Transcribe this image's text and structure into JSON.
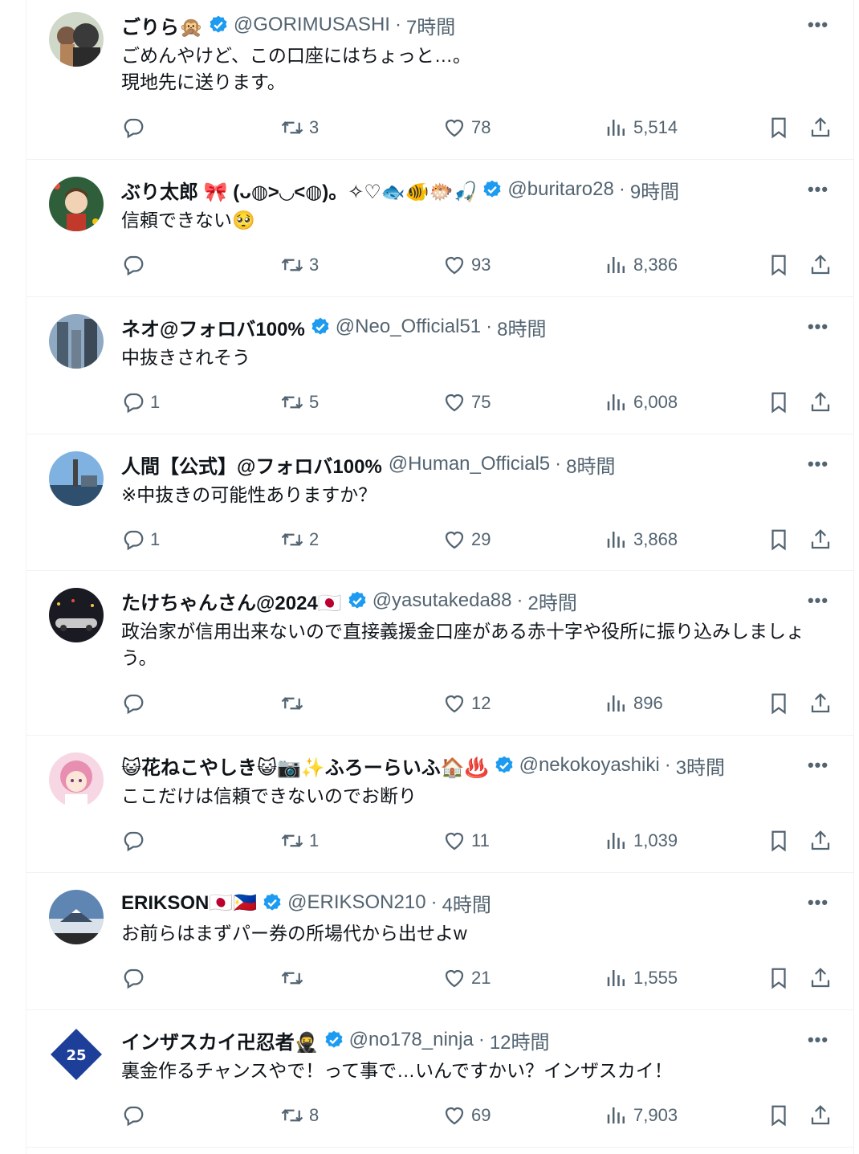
{
  "tweets": [
    {
      "name": "ごりら🙊",
      "verified": true,
      "handle": "@GORIMUSASHI",
      "time": "7時間",
      "text": "ごめんやけど、この口座にはちょっと…。\n現地先に送ります。",
      "replies": "",
      "retweets": "3",
      "likes": "78",
      "views": "5,514",
      "avatar_colors": [
        "#cfd8c9",
        "#3a3a3a"
      ]
    },
    {
      "name": "ぶり太郎 🎀 (ᴗ◍>◡<◍)。✧♡🐟🐠🐡🎣",
      "verified": true,
      "handle": "@buritaro28",
      "time": "9時間",
      "text": "信頼できない🥺",
      "replies": "",
      "retweets": "3",
      "likes": "93",
      "views": "8,386",
      "avatar_colors": [
        "#2e5f3a",
        "#c0392b"
      ]
    },
    {
      "name": "ネオ@フォロバ100%",
      "verified": true,
      "handle": "@Neo_Official51",
      "time": "8時間",
      "text": "中抜きされそう",
      "replies": "1",
      "retweets": "5",
      "likes": "75",
      "views": "6,008",
      "avatar_colors": [
        "#8fa9c2",
        "#4b5e70"
      ]
    },
    {
      "name": "人間【公式】@フォロバ100%",
      "verified": false,
      "handle": "@Human_Official5",
      "time": "8時間",
      "text": "※中抜きの可能性ありますか？",
      "replies": "1",
      "retweets": "2",
      "likes": "29",
      "views": "3,868",
      "avatar_colors": [
        "#7fb2e0",
        "#2f4f6f"
      ]
    },
    {
      "name": "たけちゃんさん@2024🇯🇵",
      "verified": true,
      "handle": "@yasutakeda88",
      "time": "2時間",
      "text": "政治家が信用出来ないので直接義援金口座がある赤十字や役所に振り込みしましょう。",
      "replies": "",
      "retweets": "",
      "likes": "12",
      "views": "896",
      "avatar_colors": [
        "#1a1a22",
        "#c8c8c8"
      ]
    },
    {
      "name": "😺花ねこやしき😺📷✨ふろーらいふ🏠♨️",
      "verified": true,
      "handle": "@nekokoyashiki",
      "time": "3時間",
      "text": "ここだけは信頼できないのでお断り",
      "replies": "",
      "retweets": "1",
      "likes": "11",
      "views": "1,039",
      "avatar_colors": [
        "#f7d7e3",
        "#e88fb1"
      ]
    },
    {
      "name": "ERIKSON🇯🇵🇵🇭",
      "verified": true,
      "handle": "@ERIKSON210",
      "time": "4時間",
      "text": "お前らはまずパー券の所場代から出せよw",
      "replies": "",
      "retweets": "",
      "likes": "21",
      "views": "1,555",
      "avatar_colors": [
        "#5f86b3",
        "#d9e2ea"
      ]
    },
    {
      "name": "インザスカイ卍忍者🥷",
      "verified": true,
      "handle": "@no178_ninja",
      "time": "12時間",
      "text": "裏金作るチャンスやで！って事で…いんですかい？インザスカイ！",
      "replies": "",
      "retweets": "8",
      "likes": "69",
      "views": "7,903",
      "avatar_colors": [
        "#ffffff",
        "#1d3f9a"
      ]
    }
  ],
  "separator": "·",
  "more_glyph": "•••",
  "colors": {
    "muted": "#536471",
    "verified": "#1d9bf0",
    "text": "#0f1419",
    "border": "#eff3f4"
  },
  "icons": [
    "reply-icon",
    "retweet-icon",
    "like-icon",
    "views-icon",
    "bookmark-icon",
    "share-icon",
    "verified-badge-icon",
    "more-icon"
  ]
}
